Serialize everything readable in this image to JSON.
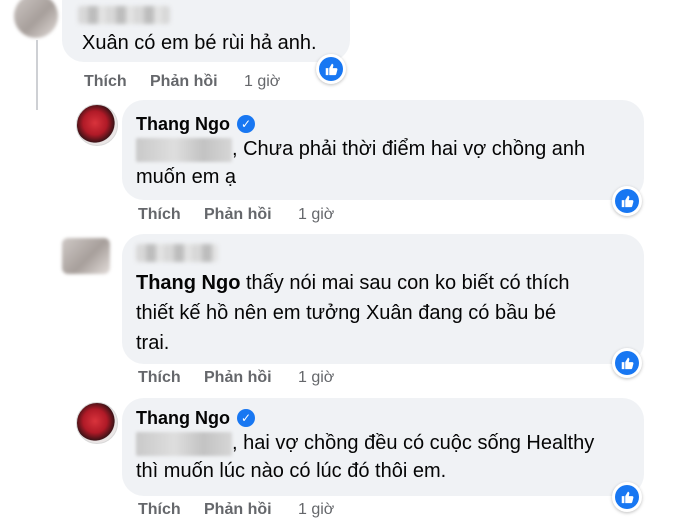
{
  "colors": {
    "bubble": "#f0f2f5",
    "meta_text": "#65676b",
    "like_blue": "#1877f2"
  },
  "icons": {
    "like": "thumbs-up-icon",
    "verified": "verified-badge-icon"
  },
  "comments": [
    {
      "text": "Xuân có em bé rùi hả anh.",
      "actions": {
        "like": "Thích",
        "reply": "Phản hồi",
        "time": "1 giờ"
      }
    },
    {
      "author": "Thang Ngo",
      "text_line1": ", Chưa phải thời điểm hai vợ chồng anh",
      "text_line2": "muốn em ạ",
      "actions": {
        "like": "Thích",
        "reply": "Phản hồi",
        "time": "1 giờ"
      }
    },
    {
      "mention": "Thang Ngo",
      "text_line1": " thấy nói mai sau con ko biết có thích",
      "text_line2": "thiết kế hồ nên em tưởng Xuân đang có bầu bé",
      "text_line3": "trai.",
      "actions": {
        "like": "Thích",
        "reply": "Phản hồi",
        "time": "1 giờ"
      }
    },
    {
      "author": "Thang Ngo",
      "text_line1": ", hai vợ chồng đều có cuộc sống Healthy",
      "text_line2": "thì muốn lúc nào có lúc đó thôi em.",
      "actions": {
        "like": "Thích",
        "reply": "Phản hồi",
        "time": "1 giờ"
      }
    }
  ]
}
